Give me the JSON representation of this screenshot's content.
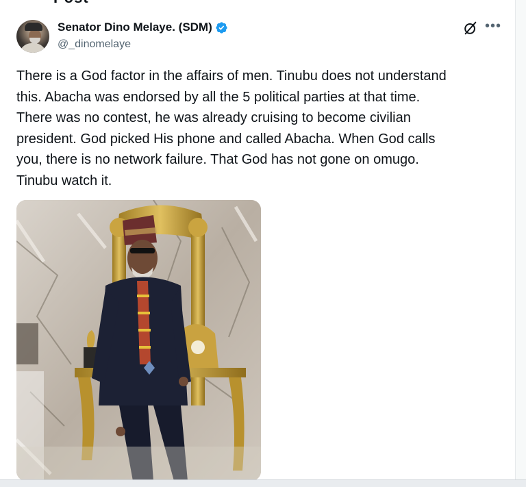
{
  "header_fragment": "Post",
  "author": {
    "display_name": "Senator Dino Melaye. (SDM)",
    "handle": "@_dinomelaye",
    "verified": true,
    "verified_color": "#1d9bf0"
  },
  "post": {
    "text": "There is a God factor in the affairs of men. Tinubu does not understand\nthis. Abacha was endorsed by all the 5 political parties at that time.\nThere was no contest, he was already cruising to become civilian\npresident. God picked His phone and called Abacha. When God calls\nyou, there is no network failure. That God has not gone on omugo.\nTinubu watch it."
  },
  "icons": {
    "grok": "grok-icon",
    "more": "more-options-icon",
    "verified": "verified-badge-icon"
  },
  "colors": {
    "text_primary": "#0f1419",
    "text_secondary": "#536471",
    "accent": "#1d9bf0"
  }
}
